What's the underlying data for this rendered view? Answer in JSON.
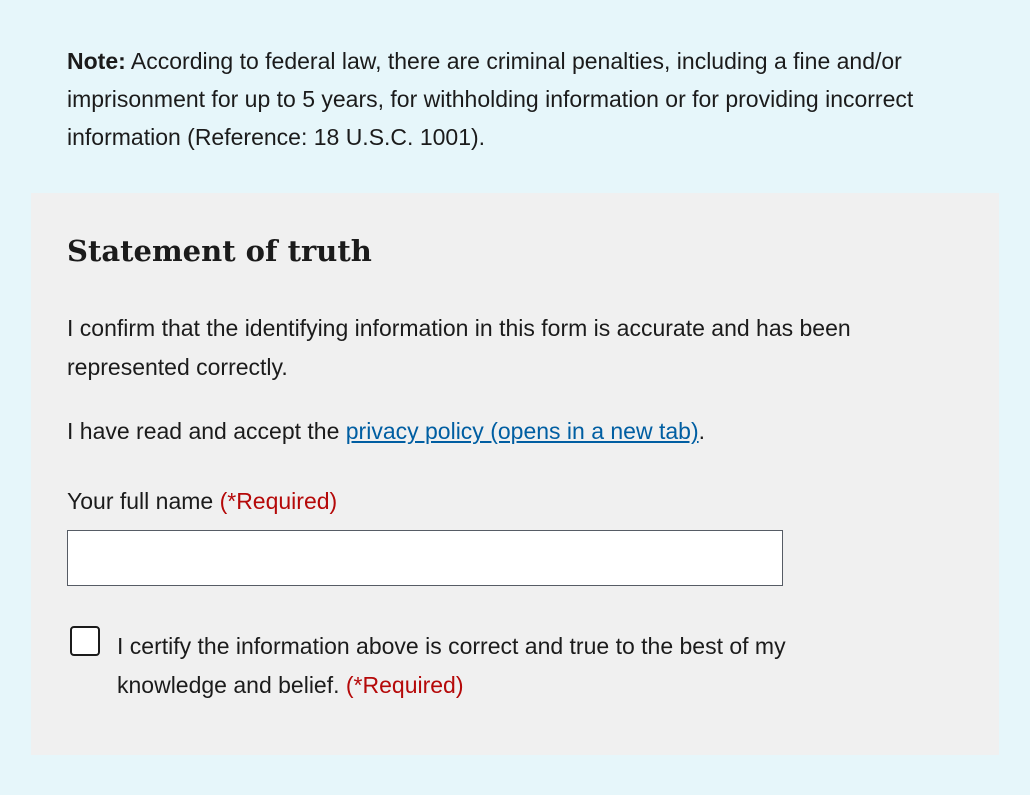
{
  "note": {
    "label": "Note:",
    "text": " According to federal law, there are criminal penalties, including a fine and/or imprisonment for up to 5 years, for withholding information or for providing incorrect information (Reference: 18 U.S.C. 1001)."
  },
  "statement": {
    "title": "Statement of truth",
    "confirm_text": "I confirm that the identifying information in this form is accurate and has been represented correctly.",
    "privacy_prefix": "I have read and accept the ",
    "privacy_link": "privacy policy (opens in a new tab)",
    "privacy_suffix": ".",
    "full_name_label": "Your full name ",
    "full_name_required": "(*Required)",
    "full_name_value": "",
    "certify_text": "I certify the information above is correct and true to the best of my knowledge and belief. ",
    "certify_required": "(*Required)",
    "certify_checked": false
  }
}
